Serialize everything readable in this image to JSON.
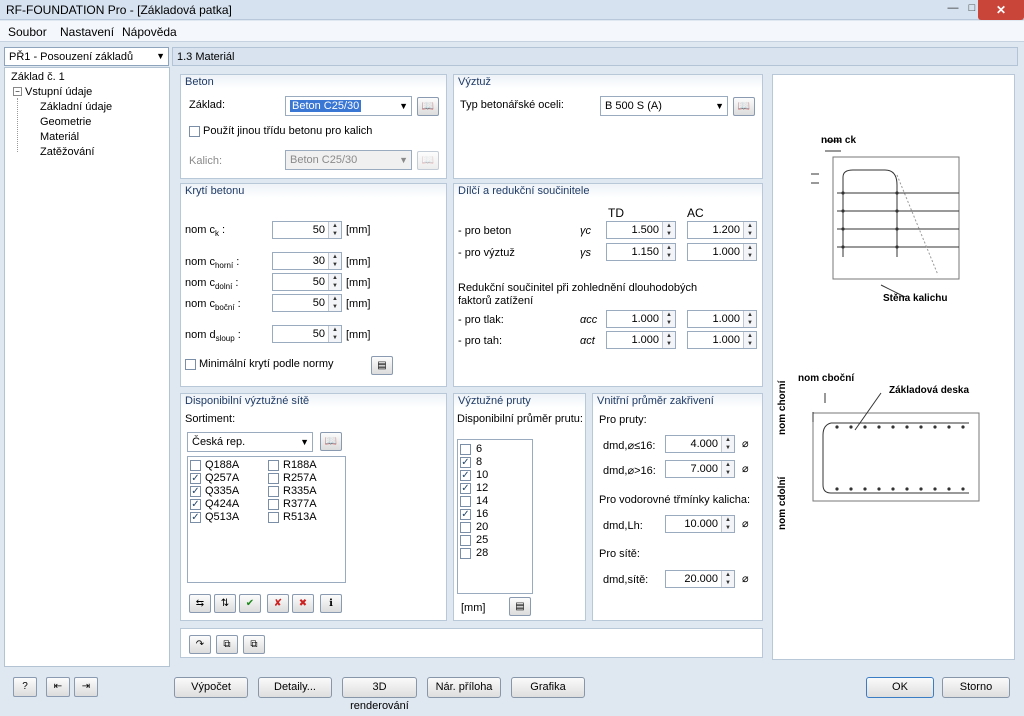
{
  "window": {
    "title": "RF-FOUNDATION Pro - [Základová patka]",
    "close": "✕",
    "min": "—",
    "max": "□"
  },
  "menu": [
    "Soubor",
    "Nastavení",
    "Nápověda"
  ],
  "nav": {
    "selector": "PŘ1 - Posouzení základů",
    "root": "Základ č. 1",
    "group": "Vstupní údaje",
    "items": [
      "Základní údaje",
      "Geometrie",
      "Materiál",
      "Zatěžování"
    ]
  },
  "section_title": "1.3 Materiál",
  "beton": {
    "title": "Beton",
    "zaklad_label": "Základ:",
    "zaklad_value": "Beton C25/30",
    "use_other_label": "Použít jinou třídu betonu pro kalich",
    "kalich_label": "Kalich:",
    "kalich_value": "Beton C25/30"
  },
  "vyztuz": {
    "title": "Výztuž",
    "type_label": "Typ betonářské oceli:",
    "type_value": "B 500 S (A)"
  },
  "kryti": {
    "title": "Krytí betonu",
    "unit": "[mm]",
    "rows": [
      {
        "label": "nom c",
        "sub": "k",
        "value": "50"
      },
      {
        "label": "nom c",
        "sub": "horní",
        "value": "30"
      },
      {
        "label": "nom c",
        "sub": "dolní",
        "value": "50"
      },
      {
        "label": "nom c",
        "sub": "boční",
        "value": "50"
      },
      {
        "label": "nom d",
        "sub": "sloup",
        "value": "50"
      }
    ],
    "min_label": "Minimální krytí podle normy"
  },
  "soucinitele": {
    "title": "Dílčí a redukční součinitele",
    "col_td": "TD",
    "col_ac": "AC",
    "rows": [
      {
        "label": "- pro beton",
        "sym": "γc",
        "td": "1.500",
        "ac": "1.200"
      },
      {
        "label": "- pro výztuž",
        "sym": "γs",
        "td": "1.150",
        "ac": "1.000"
      }
    ],
    "reduction_text": "Redukční součinitel při zohlednění dlouhodobých faktorů zatížení",
    "rows2": [
      {
        "label": "- pro tlak:",
        "sym": "αcc",
        "td": "1.000",
        "ac": "1.000"
      },
      {
        "label": "- pro tah:",
        "sym": "αct",
        "td": "1.000",
        "ac": "1.000"
      }
    ]
  },
  "site": {
    "title": "Disponibilní výztužné sítě",
    "sortiment_label": "Sortiment:",
    "sortiment_value": "Česká rep.",
    "col1": [
      {
        "name": "Q188A",
        "checked": false
      },
      {
        "name": "Q257A",
        "checked": true
      },
      {
        "name": "Q335A",
        "checked": true
      },
      {
        "name": "Q424A",
        "checked": true
      },
      {
        "name": "Q513A",
        "checked": true
      }
    ],
    "col2": [
      {
        "name": "R188A",
        "checked": false
      },
      {
        "name": "R257A",
        "checked": false
      },
      {
        "name": "R335A",
        "checked": false
      },
      {
        "name": "R377A",
        "checked": false
      },
      {
        "name": "R513A",
        "checked": false
      }
    ]
  },
  "pruty": {
    "title": "Výztužné pruty",
    "list_label": "Disponibilní průměr prutu:",
    "unit": "[mm]",
    "items": [
      {
        "d": "6",
        "checked": false
      },
      {
        "d": "8",
        "checked": true
      },
      {
        "d": "10",
        "checked": true
      },
      {
        "d": "12",
        "checked": true
      },
      {
        "d": "14",
        "checked": false
      },
      {
        "d": "16",
        "checked": true
      },
      {
        "d": "20",
        "checked": false
      },
      {
        "d": "25",
        "checked": false
      },
      {
        "d": "28",
        "checked": false
      }
    ]
  },
  "zakriveni": {
    "title": "Vnitřní průměr zakřivení",
    "pro_pruty": "Pro pruty:",
    "d1_label": "dmd,⌀≤16:",
    "d1_value": "4.000",
    "d2_label": "dmd,⌀>16:",
    "d2_value": "7.000",
    "pro_trminky": "Pro vodorovné třmínky kalicha:",
    "d3_label": "dmd,Lh:",
    "d3_value": "10.000",
    "pro_site": "Pro sítě:",
    "d4_label": "dmd,sítě:",
    "d4_value": "20.000"
  },
  "figure": {
    "nom_ck": "nom ck",
    "stena": "Stěna kalichu",
    "nom_cbocni": "nom cboční",
    "deska": "Základová deska",
    "nom_chorni": "nom chorní",
    "nom_cdolni": "nom cdolní"
  },
  "bottom": {
    "vypocet": "Výpočet",
    "detaily": "Detaily...",
    "render": "3D renderování",
    "priloha": "Nár. příloha",
    "grafika": "Grafika",
    "ok": "OK",
    "storno": "Storno"
  }
}
